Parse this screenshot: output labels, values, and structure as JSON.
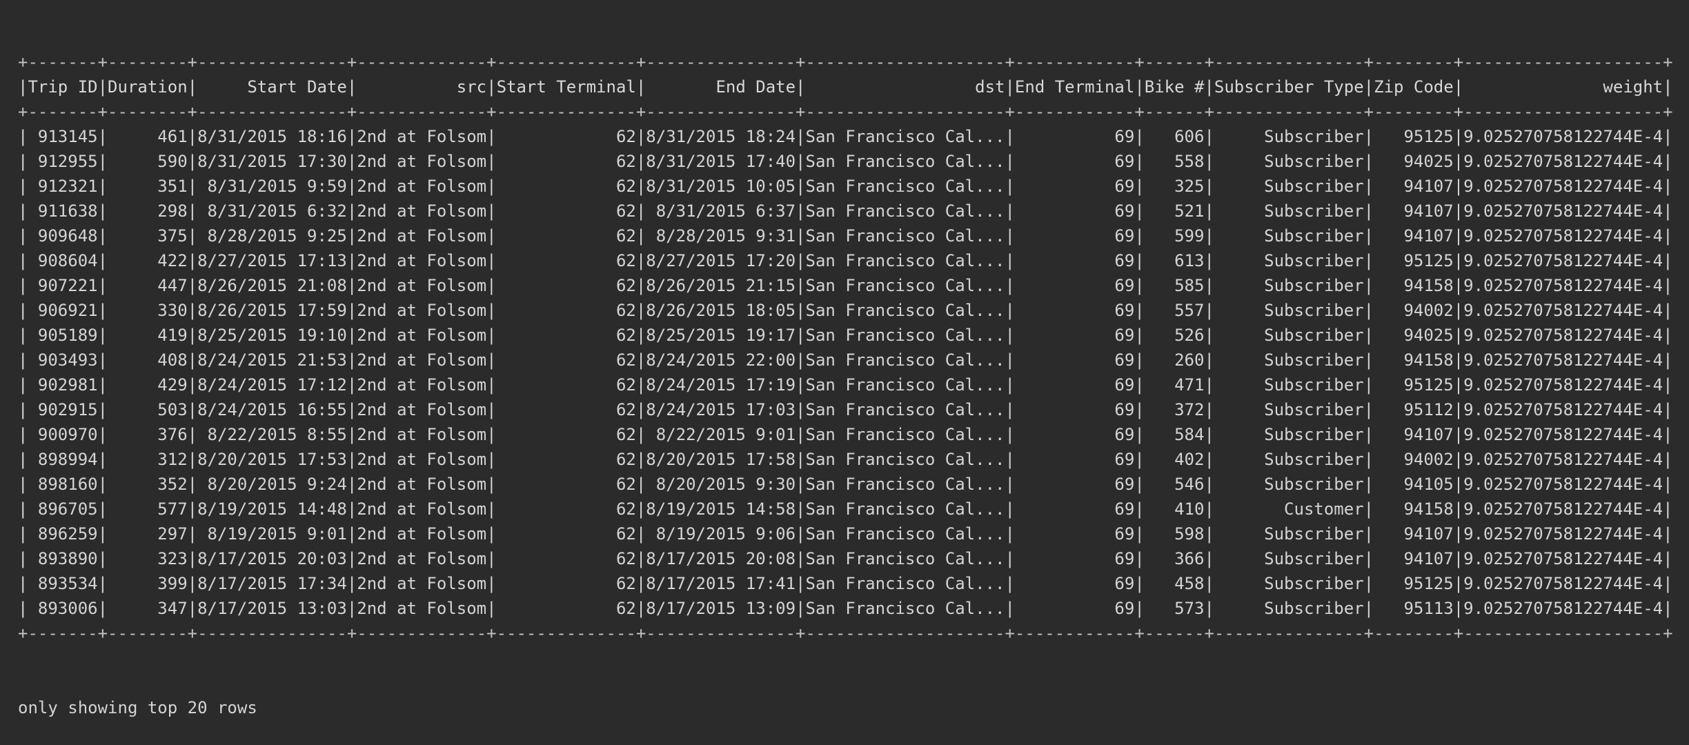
{
  "table": {
    "columns": [
      "Trip ID",
      "Duration",
      "Start Date",
      "src",
      "Start Terminal",
      "End Date",
      "dst",
      "End Terminal",
      "Bike #",
      "Subscriber Type",
      "Zip Code",
      "weight"
    ],
    "rows": [
      [
        "913145",
        "461",
        "8/31/2015 18:16",
        "2nd at Folsom",
        "62",
        "8/31/2015 18:24",
        "San Francisco Cal...",
        "69",
        "606",
        "Subscriber",
        "95125",
        "9.025270758122744E-4"
      ],
      [
        "912955",
        "590",
        "8/31/2015 17:30",
        "2nd at Folsom",
        "62",
        "8/31/2015 17:40",
        "San Francisco Cal...",
        "69",
        "558",
        "Subscriber",
        "94025",
        "9.025270758122744E-4"
      ],
      [
        "912321",
        "351",
        "8/31/2015 9:59",
        "2nd at Folsom",
        "62",
        "8/31/2015 10:05",
        "San Francisco Cal...",
        "69",
        "325",
        "Subscriber",
        "94107",
        "9.025270758122744E-4"
      ],
      [
        "911638",
        "298",
        "8/31/2015 6:32",
        "2nd at Folsom",
        "62",
        "8/31/2015 6:37",
        "San Francisco Cal...",
        "69",
        "521",
        "Subscriber",
        "94107",
        "9.025270758122744E-4"
      ],
      [
        "909648",
        "375",
        "8/28/2015 9:25",
        "2nd at Folsom",
        "62",
        "8/28/2015 9:31",
        "San Francisco Cal...",
        "69",
        "599",
        "Subscriber",
        "94107",
        "9.025270758122744E-4"
      ],
      [
        "908604",
        "422",
        "8/27/2015 17:13",
        "2nd at Folsom",
        "62",
        "8/27/2015 17:20",
        "San Francisco Cal...",
        "69",
        "613",
        "Subscriber",
        "95125",
        "9.025270758122744E-4"
      ],
      [
        "907221",
        "447",
        "8/26/2015 21:08",
        "2nd at Folsom",
        "62",
        "8/26/2015 21:15",
        "San Francisco Cal...",
        "69",
        "585",
        "Subscriber",
        "94158",
        "9.025270758122744E-4"
      ],
      [
        "906921",
        "330",
        "8/26/2015 17:59",
        "2nd at Folsom",
        "62",
        "8/26/2015 18:05",
        "San Francisco Cal...",
        "69",
        "557",
        "Subscriber",
        "94002",
        "9.025270758122744E-4"
      ],
      [
        "905189",
        "419",
        "8/25/2015 19:10",
        "2nd at Folsom",
        "62",
        "8/25/2015 19:17",
        "San Francisco Cal...",
        "69",
        "526",
        "Subscriber",
        "94025",
        "9.025270758122744E-4"
      ],
      [
        "903493",
        "408",
        "8/24/2015 21:53",
        "2nd at Folsom",
        "62",
        "8/24/2015 22:00",
        "San Francisco Cal...",
        "69",
        "260",
        "Subscriber",
        "94158",
        "9.025270758122744E-4"
      ],
      [
        "902981",
        "429",
        "8/24/2015 17:12",
        "2nd at Folsom",
        "62",
        "8/24/2015 17:19",
        "San Francisco Cal...",
        "69",
        "471",
        "Subscriber",
        "95125",
        "9.025270758122744E-4"
      ],
      [
        "902915",
        "503",
        "8/24/2015 16:55",
        "2nd at Folsom",
        "62",
        "8/24/2015 17:03",
        "San Francisco Cal...",
        "69",
        "372",
        "Subscriber",
        "95112",
        "9.025270758122744E-4"
      ],
      [
        "900970",
        "376",
        "8/22/2015 8:55",
        "2nd at Folsom",
        "62",
        "8/22/2015 9:01",
        "San Francisco Cal...",
        "69",
        "584",
        "Subscriber",
        "94107",
        "9.025270758122744E-4"
      ],
      [
        "898994",
        "312",
        "8/20/2015 17:53",
        "2nd at Folsom",
        "62",
        "8/20/2015 17:58",
        "San Francisco Cal...",
        "69",
        "402",
        "Subscriber",
        "94002",
        "9.025270758122744E-4"
      ],
      [
        "898160",
        "352",
        "8/20/2015 9:24",
        "2nd at Folsom",
        "62",
        "8/20/2015 9:30",
        "San Francisco Cal...",
        "69",
        "546",
        "Subscriber",
        "94105",
        "9.025270758122744E-4"
      ],
      [
        "896705",
        "577",
        "8/19/2015 14:48",
        "2nd at Folsom",
        "62",
        "8/19/2015 14:58",
        "San Francisco Cal...",
        "69",
        "410",
        "Customer",
        "94158",
        "9.025270758122744E-4"
      ],
      [
        "896259",
        "297",
        "8/19/2015 9:01",
        "2nd at Folsom",
        "62",
        "8/19/2015 9:06",
        "San Francisco Cal...",
        "69",
        "598",
        "Subscriber",
        "94107",
        "9.025270758122744E-4"
      ],
      [
        "893890",
        "323",
        "8/17/2015 20:03",
        "2nd at Folsom",
        "62",
        "8/17/2015 20:08",
        "San Francisco Cal...",
        "69",
        "366",
        "Subscriber",
        "94107",
        "9.025270758122744E-4"
      ],
      [
        "893534",
        "399",
        "8/17/2015 17:34",
        "2nd at Folsom",
        "62",
        "8/17/2015 17:41",
        "San Francisco Cal...",
        "69",
        "458",
        "Subscriber",
        "95125",
        "9.025270758122744E-4"
      ],
      [
        "893006",
        "347",
        "8/17/2015 13:03",
        "2nd at Folsom",
        "62",
        "8/17/2015 13:09",
        "San Francisco Cal...",
        "69",
        "573",
        "Subscriber",
        "95113",
        "9.025270758122744E-4"
      ]
    ]
  },
  "footer": "only showing top 20 rows"
}
